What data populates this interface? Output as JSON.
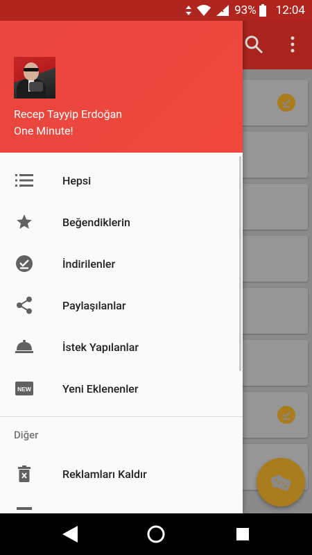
{
  "status_bar": {
    "battery_percent": "93%",
    "time": "12:04"
  },
  "drawer": {
    "header": {
      "title": "Recep Tayyip Erdoğan",
      "subtitle": "One Minute!"
    },
    "items": [
      {
        "label": "Hepsi",
        "icon": "list-icon"
      },
      {
        "label": "Beğendiklerin",
        "icon": "star-icon"
      },
      {
        "label": "İndirilenler",
        "icon": "download-done-icon"
      },
      {
        "label": "Paylaşılanlar",
        "icon": "share-icon"
      },
      {
        "label": "İstek Yapılanlar",
        "icon": "room-service-icon"
      },
      {
        "label": "Yeni Eklenenler",
        "icon": "new-badge-icon"
      }
    ],
    "section_title": "Diğer",
    "other_items": [
      {
        "label": "Reklamları Kaldır",
        "icon": "delete-icon"
      }
    ]
  },
  "colors": {
    "header_red": "#f0473c",
    "status_bar": "#b0261e",
    "accent_gold": "#f4b62e"
  }
}
